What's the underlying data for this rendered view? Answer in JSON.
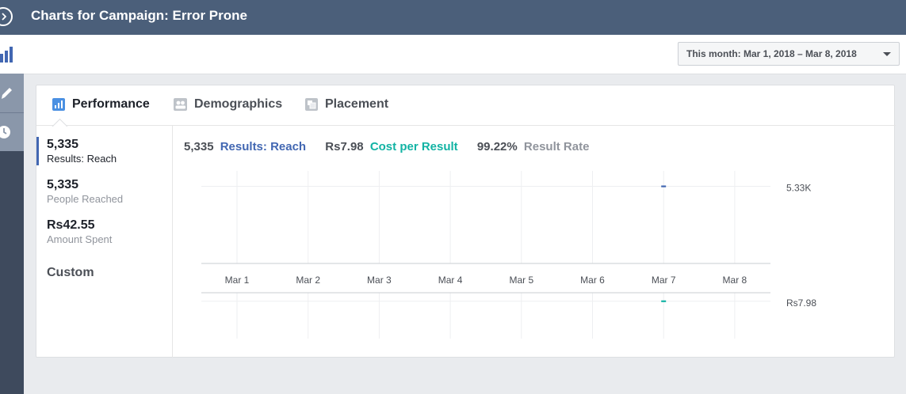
{
  "header": {
    "title": "Charts for Campaign: Error Prone"
  },
  "date_range": {
    "label": "This month: Mar 1, 2018 – Mar 8, 2018"
  },
  "tabs": [
    {
      "label": "Performance",
      "icon": "bar-chart-icon",
      "active": true
    },
    {
      "label": "Demographics",
      "icon": "people-icon",
      "active": false
    },
    {
      "label": "Placement",
      "icon": "placement-icon",
      "active": false
    }
  ],
  "metrics": [
    {
      "value": "5,335",
      "label": "Results: Reach",
      "selected": true
    },
    {
      "value": "5,335",
      "label": "People Reached",
      "selected": false
    },
    {
      "value": "Rs42.55",
      "label": "Amount Spent",
      "selected": false
    },
    {
      "value": "Custom",
      "label": "",
      "selected": false
    }
  ],
  "summary": {
    "results_value": "5,335",
    "results_label": "Results: Reach",
    "cost_value": "Rs7.98",
    "cost_label": "Cost per Result",
    "rate_value": "99.22%",
    "rate_label": "Result Rate"
  },
  "colors": {
    "accent": "#4267b2",
    "teal": "#12b3a4",
    "topbar": "#4b5f7a"
  },
  "chart_data": [
    {
      "type": "line",
      "x": [
        "Mar 1",
        "Mar 2",
        "Mar 3",
        "Mar 4",
        "Mar 5",
        "Mar 6",
        "Mar 7",
        "Mar 8"
      ],
      "series": [
        {
          "name": "Results: Reach",
          "values": [
            null,
            null,
            null,
            null,
            null,
            null,
            5330,
            null
          ],
          "color": "#4267b2"
        }
      ],
      "y_ticks": [
        {
          "value": 5330,
          "label": "5.33K"
        }
      ],
      "ylim": [
        0,
        6400
      ],
      "grid": true
    },
    {
      "type": "line",
      "x": [
        "Mar 1",
        "Mar 2",
        "Mar 3",
        "Mar 4",
        "Mar 5",
        "Mar 6",
        "Mar 7",
        "Mar 8"
      ],
      "series": [
        {
          "name": "Cost per Result",
          "values": [
            null,
            null,
            null,
            null,
            null,
            null,
            7.98,
            null
          ],
          "color": "#12b3a4"
        }
      ],
      "y_ticks": [
        {
          "value": 7.98,
          "label": "Rs7.98"
        }
      ],
      "ylim": [
        0,
        9.8
      ],
      "grid": true
    }
  ]
}
